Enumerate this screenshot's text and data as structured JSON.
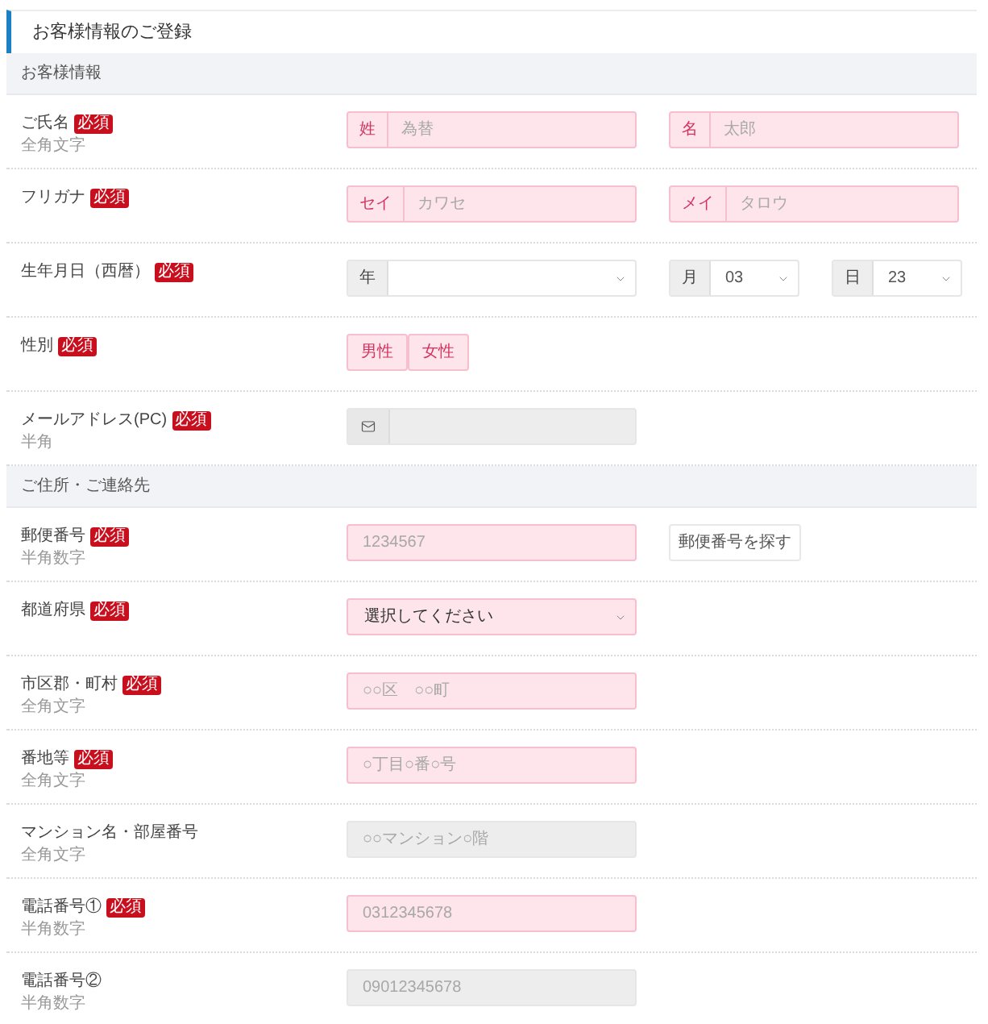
{
  "page_title": "お客様情報のご登録",
  "sections": [
    {
      "title": "お客様情報",
      "rows": [
        {
          "label": "ご氏名",
          "badge": "必須",
          "hint": "全角文字",
          "controls": [
            {
              "kind": "input",
              "addon": "姓",
              "placeholder": "為替",
              "invalid": true
            },
            {
              "kind": "input",
              "addon": "名",
              "placeholder": "太郎",
              "invalid": true
            }
          ]
        },
        {
          "label": "フリガナ",
          "badge": "必須",
          "controls": [
            {
              "kind": "input",
              "addon": "セイ",
              "placeholder": "カワセ",
              "invalid": true
            },
            {
              "kind": "input",
              "addon": "メイ",
              "placeholder": "タロウ",
              "invalid": true
            }
          ]
        },
        {
          "label": "生年月日（西暦）",
          "badge": "必須",
          "controls": [
            {
              "kind": "select",
              "addon": "年",
              "invalid": false
            },
            {
              "kind": "short_select",
              "addon": "月",
              "value": "03",
              "invalid": false
            },
            {
              "kind": "short_select",
              "addon": "日",
              "value": "23",
              "invalid": false
            }
          ]
        },
        {
          "label": "性別",
          "badge": "必須",
          "controls": [
            {
              "kind": "choice",
              "options": [
                {
                  "label": "男性",
                  "selected": false
                },
                {
                  "label": "女性",
                  "selected": false
                }
              ]
            }
          ]
        },
        {
          "label": "メールアドレス(PC)",
          "badge": "必須",
          "hint": "半角",
          "controls": [
            {
              "kind": "email",
              "invalid": false
            }
          ]
        }
      ]
    },
    {
      "title": "ご住所・ご連絡先",
      "rows": [
        {
          "label": "郵便番号",
          "badge": "必須",
          "hint": "半角数字",
          "controls": [
            {
              "kind": "input",
              "placeholder": "1234567",
              "invalid": true
            },
            {
              "kind": "button",
              "label": "郵便番号を探す"
            }
          ]
        },
        {
          "label": "都道府県",
          "badge": "必須",
          "controls": [
            {
              "kind": "select",
              "value": "選択してください",
              "invalid": true
            }
          ]
        },
        {
          "label": "市区郡・町村",
          "badge": "必須",
          "hint": "全角文字",
          "controls": [
            {
              "kind": "input",
              "placeholder": "○○区　○○町",
              "invalid": true
            }
          ]
        },
        {
          "label": "番地等",
          "badge": "必須",
          "hint": "全角文字",
          "controls": [
            {
              "kind": "input",
              "placeholder": "○丁目○番○号",
              "invalid": true
            }
          ]
        },
        {
          "label": "マンション名・部屋番号",
          "hint": "全角文字",
          "controls": [
            {
              "kind": "input",
              "placeholder": "○○マンション○階",
              "invalid": false
            }
          ]
        },
        {
          "label": "電話番号①",
          "badge": "必須",
          "hint": "半角数字",
          "controls": [
            {
              "kind": "input",
              "placeholder": "0312345678",
              "invalid": true
            }
          ]
        },
        {
          "label": "電話番号②",
          "hint": "半角数字",
          "controls": [
            {
              "kind": "input",
              "placeholder": "09012345678",
              "invalid": false
            }
          ]
        }
      ]
    }
  ]
}
